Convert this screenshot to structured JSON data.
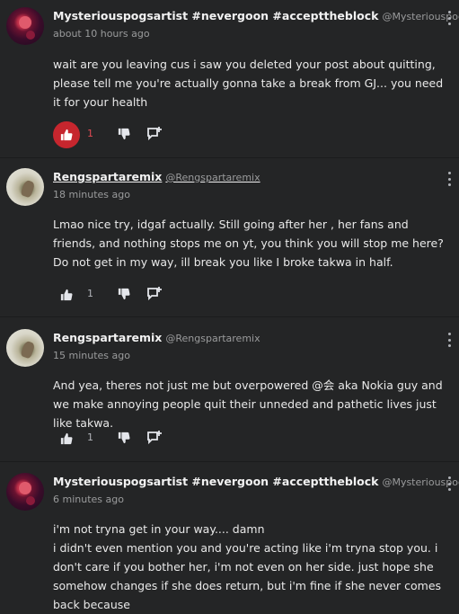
{
  "comments": [
    {
      "author": "Mysteriouspogsartist #nevergoon #accepttheblock",
      "handle": "@Mysteriouspog...",
      "time": "about 10 hours ago",
      "text": "wait are you leaving cus i saw you deleted your post about quitting, please tell me you're actually gonna take a break from GJ... you need it for your health",
      "likes": "1",
      "liked": true,
      "avatar_icon": "avatar-dark-icon"
    },
    {
      "author": "Rengspartaremix",
      "handle": "@Rengspartaremix",
      "time": "18 minutes ago",
      "text": "Lmao nice try, idgaf actually. Still going after her , her fans and friends, and nothing stops me on yt, you think you will stop me here? Do not get in my way, ill break you like I broke takwa in half.",
      "likes": "1",
      "liked": false,
      "avatar_icon": "avatar-light-icon"
    },
    {
      "author": "Rengspartaremix",
      "handle": "@Rengspartaremix",
      "time": "15 minutes ago",
      "text": "And yea, theres not just me but overpowered @会 aka Nokia guy and we make annoying people quit their unneded and pathetic lives just like takwa.",
      "likes": "1",
      "liked": false,
      "avatar_icon": "avatar-light-icon"
    },
    {
      "author": "Mysteriouspogsartist #nevergoon #accepttheblock",
      "handle": "@Mysteriouspog...",
      "time": "6 minutes ago",
      "text": "i'm not tryna get in your way.... damn\ni didn't even mention you and you're acting like i'm tryna stop you. i don't care if you bother her, i'm not even on her side. just hope she somehow changes if she does return, but i'm fine if she never comes back because",
      "avatar_icon": "avatar-dark-icon"
    }
  ],
  "colors": {
    "background": "#242526",
    "like_active": "#c6262e"
  }
}
